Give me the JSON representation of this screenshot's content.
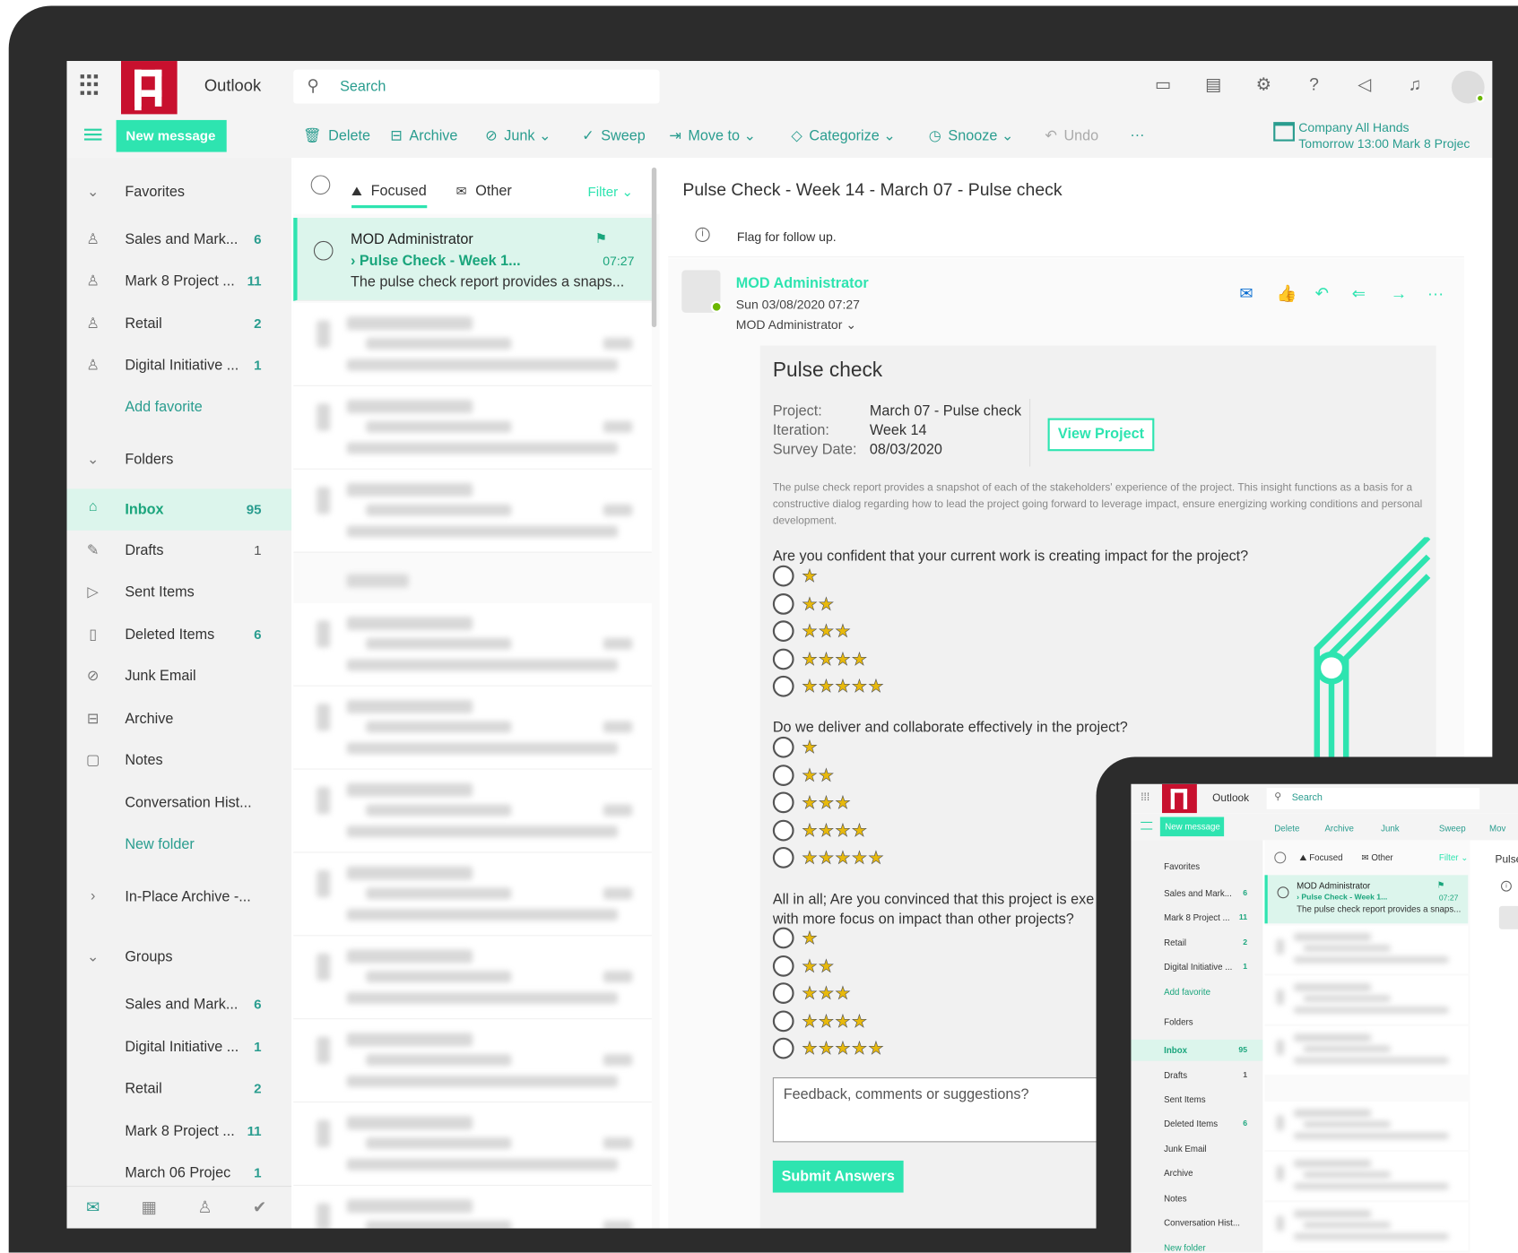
{
  "app": {
    "title": "Outlook",
    "search_placeholder": "Search"
  },
  "toolbar": {
    "new_message": "New message",
    "delete": "Delete",
    "archive": "Archive",
    "junk": "Junk",
    "sweep": "Sweep",
    "move_to": "Move to",
    "categorize": "Categorize",
    "snooze": "Snooze",
    "undo": "Undo",
    "more": "···"
  },
  "upcoming": {
    "title": "Company All Hands",
    "detail": "Tomorrow 13:00 Mark 8 Projec"
  },
  "nav": {
    "favorites_header": "Favorites",
    "favorites": [
      {
        "label": "Sales and Mark...",
        "count": "6"
      },
      {
        "label": "Mark 8 Project ...",
        "count": "11"
      },
      {
        "label": "Retail",
        "count": "2"
      },
      {
        "label": "Digital Initiative ...",
        "count": "1"
      }
    ],
    "add_favorite": "Add favorite",
    "folders_header": "Folders",
    "folders": [
      {
        "label": "Inbox",
        "count": "95"
      },
      {
        "label": "Drafts",
        "count": "1"
      },
      {
        "label": "Sent Items",
        "count": ""
      },
      {
        "label": "Deleted Items",
        "count": "6"
      },
      {
        "label": "Junk Email",
        "count": ""
      },
      {
        "label": "Archive",
        "count": ""
      },
      {
        "label": "Notes",
        "count": ""
      },
      {
        "label": "Conversation Hist...",
        "count": ""
      }
    ],
    "new_folder": "New folder",
    "in_place_archive": "In-Place Archive -...",
    "groups_header": "Groups",
    "groups": [
      {
        "label": "Sales and Mark...",
        "count": "6"
      },
      {
        "label": "Digital Initiative ...",
        "count": "1"
      },
      {
        "label": "Retail",
        "count": "2"
      },
      {
        "label": "Mark 8 Project ...",
        "count": "11"
      },
      {
        "label": "March 06 Projec",
        "count": "1"
      }
    ]
  },
  "list": {
    "focused": "Focused",
    "other": "Other",
    "filter": "Filter",
    "selected": {
      "from": "MOD Administrator",
      "subject": "Pulse Check - Week 1...",
      "time": "07:27",
      "preview": "The pulse check report provides a snaps..."
    }
  },
  "reading": {
    "subject": "Pulse Check - Week 14 - March 07 - Pulse check",
    "flag_note": "Flag for follow up.",
    "sender": "MOD Administrator",
    "date": "Sun 03/08/2020 07:27",
    "to": "MOD Administrator",
    "card": {
      "title": "Pulse check",
      "labels": [
        "Project:",
        "Iteration:",
        "Survey Date:"
      ],
      "values": [
        "March 07 - Pulse check",
        "Week 14",
        "08/03/2020"
      ],
      "view_project": "View Project",
      "description": "The pulse check report provides a snapshot of each of the stakeholders' experience of the project. This insight functions as a basis for a constructive dialog regarding how to lead the project going forward to leverage impact, ensure energizing working conditions and personal development.",
      "questions": [
        "Are you confident that your current work is creating impact for the project?",
        "Do we deliver and collaborate effectively in the project?",
        "All in all; Are you convinced that this project is exe with more focus on impact than other projects?"
      ],
      "ratings": [
        "★",
        "★★",
        "★★★",
        "★★★★",
        "★★★★★"
      ],
      "feedback_placeholder": "Feedback, comments or suggestions?",
      "submit": "Submit Answers"
    }
  },
  "mini": {
    "title": "Outlook",
    "search": "Search",
    "new_message": "New message",
    "delete": "Delete",
    "archive": "Archive",
    "junk": "Junk",
    "sweep": "Sweep",
    "move": "Mov",
    "focused": "Focused",
    "other": "Other",
    "filter": "Filter",
    "reading_subject": "Pulse",
    "nav": [
      {
        "label": "Favorites",
        "count": ""
      },
      {
        "label": "Sales and Mark...",
        "count": "6"
      },
      {
        "label": "Mark 8 Project ...",
        "count": "11"
      },
      {
        "label": "Retail",
        "count": "2"
      },
      {
        "label": "Digital Initiative ...",
        "count": "1"
      },
      {
        "label": "Add favorite",
        "count": ""
      },
      {
        "label": "Folders",
        "count": ""
      },
      {
        "label": "Inbox",
        "count": "95"
      },
      {
        "label": "Drafts",
        "count": "1"
      },
      {
        "label": "Sent Items",
        "count": ""
      },
      {
        "label": "Deleted Items",
        "count": "6"
      },
      {
        "label": "Junk Email",
        "count": ""
      },
      {
        "label": "Archive",
        "count": ""
      },
      {
        "label": "Notes",
        "count": ""
      },
      {
        "label": "Conversation Hist...",
        "count": ""
      },
      {
        "label": "New folder",
        "count": ""
      }
    ],
    "msg": {
      "from": "MOD Administrator",
      "subject": "Pulse Check - Week 1...",
      "time": "07:27",
      "preview": "The pulse check report provides a snaps..."
    }
  },
  "colors": {
    "accent": "#2ee4b0",
    "accent_dark": "#1aa57c",
    "brand_red": "#c8102e",
    "frame": "#2c2c2c"
  }
}
